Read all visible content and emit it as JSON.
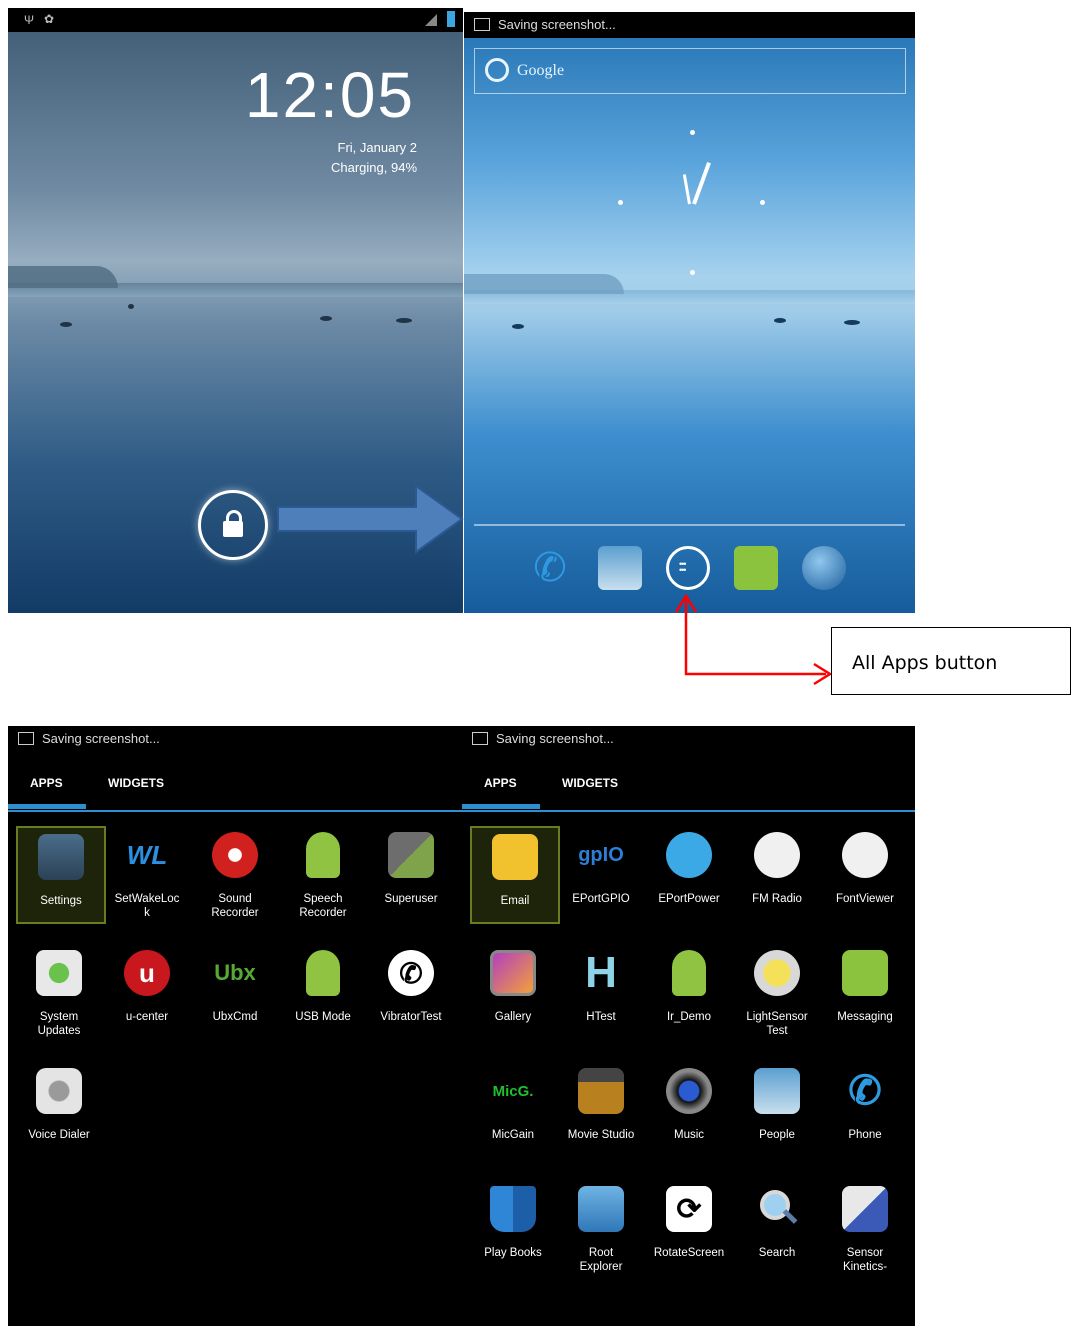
{
  "lock_screen": {
    "time": "12:05",
    "date": "Fri, January 2",
    "charging": "Charging, 94%"
  },
  "home_screen": {
    "status_text": "Saving screenshot...",
    "search_label": "Google"
  },
  "callout": {
    "label": "All Apps button",
    "arrow_color": "#ff0000"
  },
  "drawer_left": {
    "status_text": "Saving screenshot...",
    "tabs": [
      "APPS",
      "WIDGETS"
    ],
    "apps": [
      {
        "label": "Settings",
        "icon": "settings-icon"
      },
      {
        "label": "SetWakeLoc\nk",
        "icon": "wl-icon"
      },
      {
        "label": "Sound\nRecorder",
        "icon": "microphone-icon"
      },
      {
        "label": "Speech\nRecorder",
        "icon": "android-icon"
      },
      {
        "label": "Superuser",
        "icon": "superuser-icon"
      },
      {
        "label": "System\nUpdates",
        "icon": "system-updates-icon"
      },
      {
        "label": "u-center",
        "icon": "u-center-icon"
      },
      {
        "label": "UbxCmd",
        "icon": "ubx-icon"
      },
      {
        "label": "USB Mode",
        "icon": "android-icon"
      },
      {
        "label": "VibratorTest",
        "icon": "phone-icon"
      },
      {
        "label": "Voice Dialer",
        "icon": "voice-dialer-icon"
      }
    ]
  },
  "drawer_right": {
    "status_text": "Saving screenshot...",
    "tabs": [
      "APPS",
      "WIDGETS"
    ],
    "apps": [
      {
        "label": "Email",
        "icon": "email-icon"
      },
      {
        "label": "EPortGPIO",
        "icon": "gpio-icon"
      },
      {
        "label": "EPortPower",
        "icon": "eportpower-icon"
      },
      {
        "label": "FM Radio",
        "icon": "radio-icon"
      },
      {
        "label": "FontViewer",
        "icon": "fontviewer-icon"
      },
      {
        "label": "Gallery",
        "icon": "gallery-icon"
      },
      {
        "label": "HTest",
        "icon": "htest-icon"
      },
      {
        "label": "Ir_Demo",
        "icon": "android-icon"
      },
      {
        "label": "LightSensor\nTest",
        "icon": "lightbulb-icon"
      },
      {
        "label": "Messaging",
        "icon": "messaging-icon"
      },
      {
        "label": "MicGain",
        "icon": "micgain-icon"
      },
      {
        "label": "Movie Studio",
        "icon": "clapperboard-icon"
      },
      {
        "label": "Music",
        "icon": "speaker-icon"
      },
      {
        "label": "People",
        "icon": "people-icon"
      },
      {
        "label": "Phone",
        "icon": "phone-icon"
      },
      {
        "label": "Play Books",
        "icon": "book-icon"
      },
      {
        "label": "Root\nExplorer",
        "icon": "root-explorer-icon"
      },
      {
        "label": "RotateScreen",
        "icon": "rotate-icon"
      },
      {
        "label": "Search",
        "icon": "magnifier-icon"
      },
      {
        "label": "Sensor\nKinetics-",
        "icon": "sensor-kinetics-icon"
      }
    ]
  }
}
